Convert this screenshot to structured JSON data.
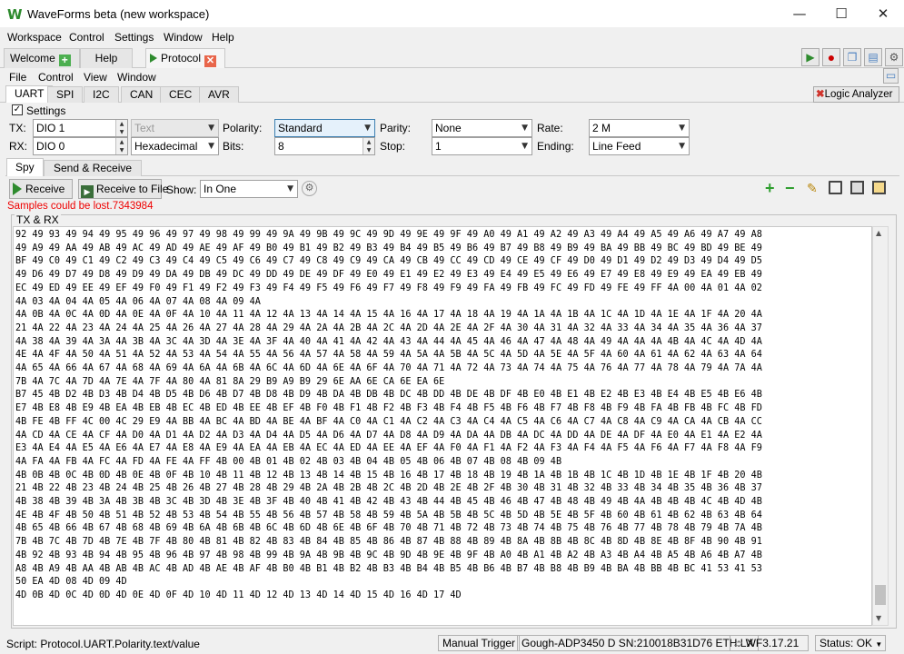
{
  "window": {
    "title": "WaveForms beta (new workspace)",
    "app_icon": "W",
    "min": "—",
    "max": "☐",
    "close": "✕"
  },
  "menu": [
    "Workspace",
    "Control",
    "Settings",
    "Window",
    "Help"
  ],
  "tabs": {
    "welcome": "Welcome",
    "help": "Help",
    "protocol": "Protocol"
  },
  "submenu": [
    "File",
    "Control",
    "View",
    "Window"
  ],
  "protocol_tabs": [
    "UART",
    "SPI",
    "I2C",
    "CAN",
    "CEC",
    "AVR"
  ],
  "logic_analyzer": "Logic Analyzer",
  "settings": {
    "checkbox_label": "Settings",
    "tx_label": "TX:",
    "tx_value": "DIO 1",
    "tx_format": "Text",
    "rx_label": "RX:",
    "rx_value": "DIO 0",
    "rx_format": "Hexadecimal",
    "polarity_label": "Polarity:",
    "polarity_value": "Standard",
    "bits_label": "Bits:",
    "bits_value": "8",
    "parity_label": "Parity:",
    "parity_value": "None",
    "stop_label": "Stop:",
    "stop_value": "1",
    "rate_label": "Rate:",
    "rate_value": "2 M",
    "ending_label": "Ending:",
    "ending_value": "Line Feed"
  },
  "spy_tabs": {
    "spy": "Spy",
    "send_receive": "Send & Receive"
  },
  "spy": {
    "receive": "Receive",
    "receive_to_file": "Receive to File",
    "show_label": "Show:",
    "show_value": "In One"
  },
  "warning": "Samples could be lost.7343984",
  "txrx_label": "TX & RX",
  "data_lines": [
    "92 49 93 49 94 49 95 49 96 49 97 49 98 49 99 49 9A 49 9B 49 9C 49 9D 49 9E 49 9F 49 A0 49 A1 49 A2 49 A3 49 A4 49 A5 49 A6 49 A7 49 A8",
    "49 A9 49 AA 49 AB 49 AC 49 AD 49 AE 49 AF 49 B0 49 B1 49 B2 49 B3 49 B4 49 B5 49 B6 49 B7 49 B8 49 B9 49 BA 49 BB 49 BC 49 BD 49 BE 49",
    "BF 49 C0 49 C1 49 C2 49 C3 49 C4 49 C5 49 C6 49 C7 49 C8 49 C9 49 CA 49 CB 49 CC 49 CD 49 CE 49 CF 49 D0 49 D1 49 D2 49 D3 49 D4 49 D5",
    "49 D6 49 D7 49 D8 49 D9 49 DA 49 DB 49 DC 49 DD 49 DE 49 DF 49 E0 49 E1 49 E2 49 E3 49 E4 49 E5 49 E6 49 E7 49 E8 49 E9 49 EA 49 EB 49",
    "EC 49 ED 49 EE 49 EF 49 F0 49 F1 49 F2 49 F3 49 F4 49 F5 49 F6 49 F7 49 F8 49 F9 49 FA 49 FB 49 FC 49 FD 49 FE 49 FF 4A 00 4A 01 4A 02",
    "4A 03 4A 04 4A 05 4A 06 4A 07 4A 08 4A 09 4A",
    "4A 0B 4A 0C 4A 0D 4A 0E 4A 0F 4A 10 4A 11 4A 12 4A 13 4A 14 4A 15 4A 16 4A 17 4A 18 4A 19 4A 1A 4A 1B 4A 1C 4A 1D 4A 1E 4A 1F 4A 20 4A",
    "21 4A 22 4A 23 4A 24 4A 25 4A 26 4A 27 4A 28 4A 29 4A 2A 4A 2B 4A 2C 4A 2D 4A 2E 4A 2F 4A 30 4A 31 4A 32 4A 33 4A 34 4A 35 4A 36 4A 37",
    "4A 38 4A 39 4A 3A 4A 3B 4A 3C 4A 3D 4A 3E 4A 3F 4A 40 4A 41 4A 42 4A 43 4A 44 4A 45 4A 46 4A 47 4A 48 4A 49 4A 4A 4A 4B 4A 4C 4A 4D 4A",
    "4E 4A 4F 4A 50 4A 51 4A 52 4A 53 4A 54 4A 55 4A 56 4A 57 4A 58 4A 59 4A 5A 4A 5B 4A 5C 4A 5D 4A 5E 4A 5F 4A 60 4A 61 4A 62 4A 63 4A 64",
    "4A 65 4A 66 4A 67 4A 68 4A 69 4A 6A 4A 6B 4A 6C 4A 6D 4A 6E 4A 6F 4A 70 4A 71 4A 72 4A 73 4A 74 4A 75 4A 76 4A 77 4A 78 4A 79 4A 7A 4A",
    "7B 4A 7C 4A 7D 4A 7E 4A 7F 4A 80 4A 81 8A 29 B9 A9 B9 29 6E AA 6E CA 6E EA 6E",
    "B7 45 4B D2 4B D3 4B D4 4B D5 4B D6 4B D7 4B D8 4B D9 4B DA 4B DB 4B DC 4B DD 4B DE 4B DF 4B E0 4B E1 4B E2 4B E3 4B E4 4B E5 4B E6 4B",
    "E7 4B E8 4B E9 4B EA 4B EB 4B EC 4B ED 4B EE 4B EF 4B F0 4B F1 4B F2 4B F3 4B F4 4B F5 4B F6 4B F7 4B F8 4B F9 4B FA 4B FB 4B FC 4B FD",
    "4B FE 4B FF 4C 00 4C 29 E9 4A BB 4A BC 4A BD 4A BE 4A BF 4A C0 4A C1 4A C2 4A C3 4A C4 4A C5 4A C6 4A C7 4A C8 4A C9 4A CA 4A CB 4A CC",
    "4A CD 4A CE 4A CF 4A D0 4A D1 4A D2 4A D3 4A D4 4A D5 4A D6 4A D7 4A D8 4A D9 4A DA 4A DB 4A DC 4A DD 4A DE 4A DF 4A E0 4A E1 4A E2 4A",
    "E3 4A E4 4A E5 4A E6 4A E7 4A E8 4A E9 4A EA 4A EB 4A EC 4A ED 4A EE 4A EF 4A F0 4A F1 4A F2 4A F3 4A F4 4A F5 4A F6 4A F7 4A F8 4A F9",
    "4A FA 4A FB 4A FC 4A FD 4A FE 4A FF 4B 00 4B 01 4B 02 4B 03 4B 04 4B 05 4B 06 4B 07 4B 08 4B 09 4B",
    "4B 0B 4B 0C 4B 0D 4B 0E 4B 0F 4B 10 4B 11 4B 12 4B 13 4B 14 4B 15 4B 16 4B 17 4B 18 4B 19 4B 1A 4B 1B 4B 1C 4B 1D 4B 1E 4B 1F 4B 20 4B",
    "21 4B 22 4B 23 4B 24 4B 25 4B 26 4B 27 4B 28 4B 29 4B 2A 4B 2B 4B 2C 4B 2D 4B 2E 4B 2F 4B 30 4B 31 4B 32 4B 33 4B 34 4B 35 4B 36 4B 37",
    "4B 38 4B 39 4B 3A 4B 3B 4B 3C 4B 3D 4B 3E 4B 3F 4B 40 4B 41 4B 42 4B 43 4B 44 4B 45 4B 46 4B 47 4B 48 4B 49 4B 4A 4B 4B 4B 4C 4B 4D 4B",
    "4E 4B 4F 4B 50 4B 51 4B 52 4B 53 4B 54 4B 55 4B 56 4B 57 4B 58 4B 59 4B 5A 4B 5B 4B 5C 4B 5D 4B 5E 4B 5F 4B 60 4B 61 4B 62 4B 63 4B 64",
    "4B 65 4B 66 4B 67 4B 68 4B 69 4B 6A 4B 6B 4B 6C 4B 6D 4B 6E 4B 6F 4B 70 4B 71 4B 72 4B 73 4B 74 4B 75 4B 76 4B 77 4B 78 4B 79 4B 7A 4B",
    "7B 4B 7C 4B 7D 4B 7E 4B 7F 4B 80 4B 81 4B 82 4B 83 4B 84 4B 85 4B 86 4B 87 4B 88 4B 89 4B 8A 4B 8B 4B 8C 4B 8D 4B 8E 4B 8F 4B 90 4B 91",
    "4B 92 4B 93 4B 94 4B 95 4B 96 4B 97 4B 98 4B 99 4B 9A 4B 9B 4B 9C 4B 9D 4B 9E 4B 9F 4B A0 4B A1 4B A2 4B A3 4B A4 4B A5 4B A6 4B A7 4B",
    "A8 4B A9 4B AA 4B AB 4B AC 4B AD 4B AE 4B AF 4B B0 4B B1 4B B2 4B B3 4B B4 4B B5 4B B6 4B B7 4B B8 4B B9 4B BA 4B BB 4B BC 41 53 41 53",
    "50 EA 4D 08 4D 09 4D",
    "4D 0B 4D 0C 4D 0D 4D 0E 4D 0F 4D 10 4D 11 4D 12 4D 13 4D 14 4D 15 4D 16 4D 17 4D"
  ],
  "status": {
    "script": "Script: Protocol.UART.Polarity.text/value",
    "trigger": "Manual Trigger",
    "device": "Gough-ADP3450 D SN:210018B31D76 ETH:LX",
    "version": "WF3.17.21",
    "state": "Status: OK"
  }
}
